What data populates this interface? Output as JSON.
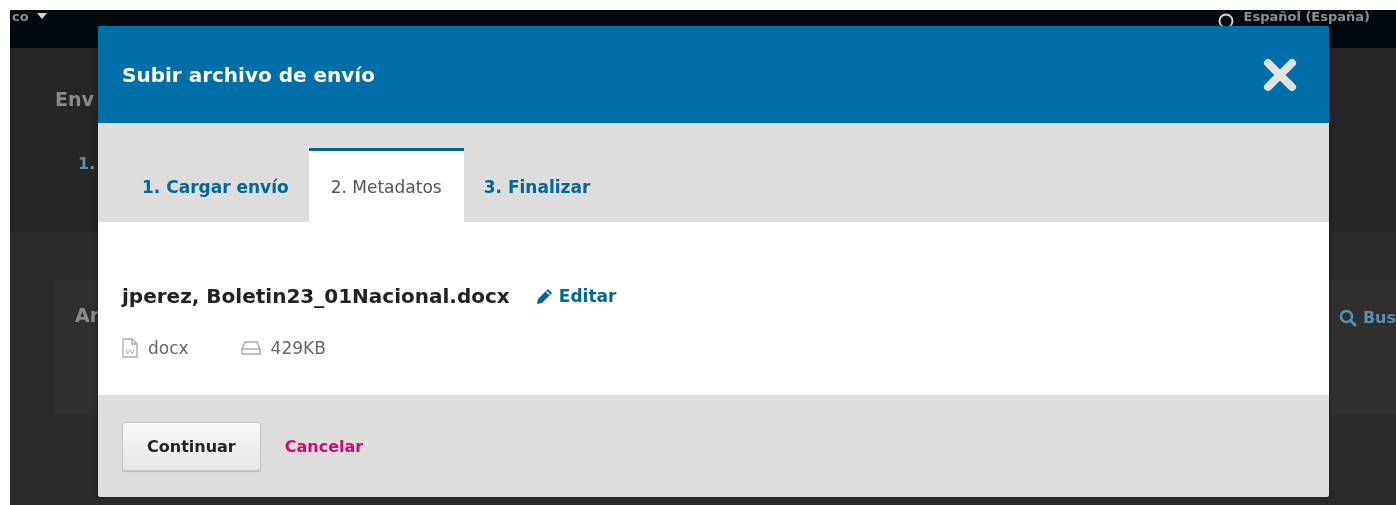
{
  "background_page": {
    "top_bar": {
      "menu_label": "co",
      "language": "Español (España)"
    },
    "heading": "Env",
    "tab": "1.",
    "card_title": "Ar",
    "search_label": "Bus"
  },
  "dialog": {
    "title": "Subir archivo de envío",
    "tabs": [
      {
        "label": "1. Cargar envío",
        "selected": false
      },
      {
        "label": "2. Metadatos",
        "selected": true
      },
      {
        "label": "3. Finalizar",
        "selected": false
      }
    ],
    "file": {
      "name": "jperez, Boletin23_01Nacional.docx",
      "edit_link": "Editar",
      "type": "docx",
      "size": "429KB"
    },
    "buttons": {
      "primary": "Continuar",
      "cancel": "Cancelar"
    }
  }
}
